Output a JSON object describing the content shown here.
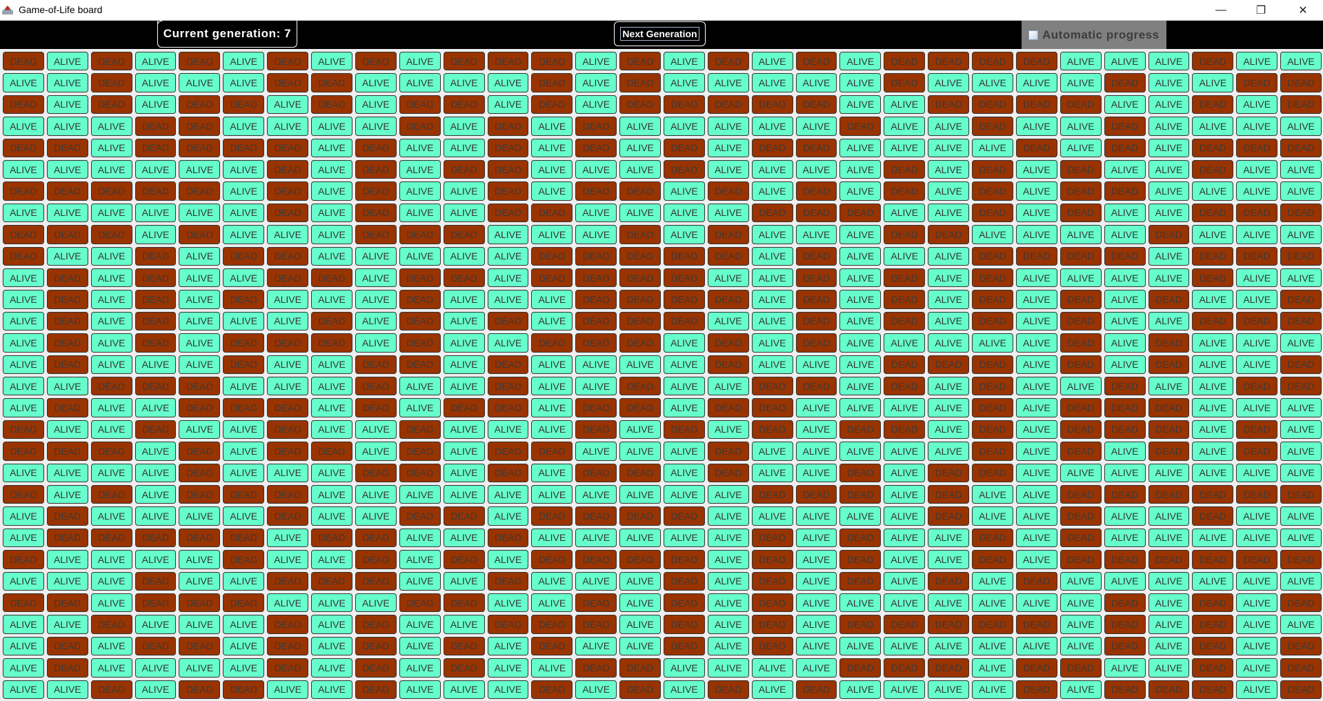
{
  "window": {
    "title": "Game-of-Life board",
    "icon": "java-app-icon",
    "controls": {
      "minimize": "—",
      "maximize": "❐",
      "close": "✕"
    }
  },
  "header": {
    "generation_label": "Current generation: 7",
    "generation": 7,
    "next_button_label": "Next Generation",
    "auto_progress_label": "Automatic progress",
    "auto_progress_checked": false
  },
  "colors": {
    "alive": "#66ffcc",
    "dead": "#993300",
    "header_bg": "#000000",
    "auto_panel_bg": "#808080"
  },
  "labels": {
    "alive": "ALIVE",
    "dead": "DEAD"
  },
  "board": {
    "rows": 30,
    "cols": 30,
    "cells": [
      "DADADADADADDDADADADADDDDAAADAA",
      "AADAAADDAAAADADAAAAADAAAADAADD",
      "DADADDADADDADADDDDDAADDDDAADAD",
      "AAADDAAAADADADAAAAADAADAADAAAA",
      "DDADDDDADAADADADADDAAAADADADDD",
      "AAAAAADADADDAAADAAAADADADAADAA",
      "DDDDDADADAADADDADADADADADDAAAA",
      "AAAAAADADAADDAAAADDDAADADAADDD",
      "DDDADAAADDDAAADADAAADDAAAADAAA",
      "DAADADDAAAAADDDDDADAAADDDDADDD",
      "ADADAADDADDADDDDAADADADAAAADAA",
      "ADADADAAADAAADDDDADADADADADAAD",
      "ADADAAADADADADDDAADADADADAADDD",
      "ADADADDDADAADDDADADAAAAADADAAA",
      "ADAAADAADDADAAAADAAADDDADADAAD",
      "AADDDAAADAADAADAADDADADAADAADD",
      "ADAADDDADADDADDADDAAAADADDDAAA",
      "DAADAADAADAAADADADADDADADDDADA",
      "DDDADADDADADDAAADAAAAADADADADA",
      "AAAADAAADDADADDADAADADDAAAAAAA",
      "DADADDDAAAAAAAAAADDDADAADDDDDD",
      "ADAAAADAADDADDDDAAAAADAADAADAA",
      "ADDDDDADDAADAAAAADADAADADAAAAA",
      "DAAAADAADADADDDDADADAADADDDDDD",
      "AAADAADDDAADAAADADADADADAAAAAA",
      "DDADDDAAADDAADADADAAAAAAADADAD",
      "AADAAADADAADDDADADADDDDDADADAA",
      "ADADDADADADADAADADAAAAAAADADAD",
      "ADAAAADADADAADDAAAADDDADDAADAD",
      "AADADDAADAAADADADADAAAADADDDAD"
    ]
  }
}
